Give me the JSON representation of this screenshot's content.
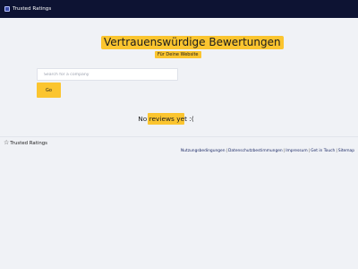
{
  "header": {
    "brand": "Trusted Ratings",
    "brand_icon": "app-logo-icon"
  },
  "hero": {
    "title": "Vertrauenswürdige Bewertungen",
    "subtitle": "Für Deine Website"
  },
  "search": {
    "placeholder": "Search for a company",
    "value": "",
    "button_label": "Go"
  },
  "results": {
    "empty_message": "No reviews yet :("
  },
  "footer": {
    "brand": "Trusted Ratings",
    "brand_icon": "star-icon",
    "links": [
      "Nutzungsbedingungen",
      "Datenschutzbestimmungen",
      "Impressum",
      "Get in Touch",
      "Sitemap"
    ],
    "separator": "|"
  },
  "colors": {
    "navbar": "#0d1333",
    "accent": "#fbc52f",
    "background": "#f0f2f6"
  }
}
